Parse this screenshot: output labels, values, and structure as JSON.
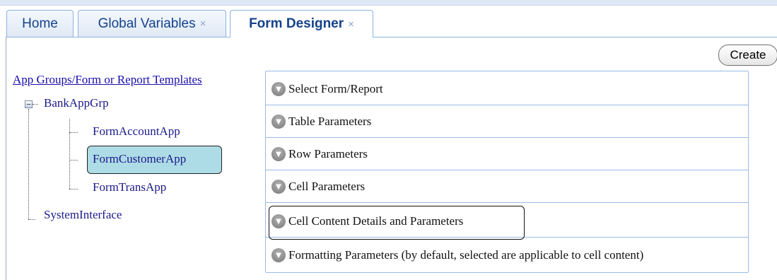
{
  "tabs": [
    {
      "label": "Home",
      "closable": false,
      "active": false
    },
    {
      "label": "Global Variables",
      "closable": true,
      "active": false
    },
    {
      "label": "Form Designer",
      "closable": true,
      "active": true
    }
  ],
  "close_glyph": "×",
  "toolbar": {
    "create_label": "Create"
  },
  "tree": {
    "root_link": "App Groups/Form or Report Templates",
    "expander_glyph": "−",
    "group": "BankAppGrp",
    "children": [
      "FormAccountApp",
      "FormCustomerApp",
      "FormTransApp"
    ],
    "selected_child": "FormCustomerApp",
    "sibling": "SystemInterface"
  },
  "accordion": {
    "sections": [
      "Select Form/Report",
      "Table Parameters",
      "Row Parameters",
      "Cell Parameters",
      "Cell Content Details and Parameters",
      "Formatting Parameters (by default, selected are applicable to cell content)"
    ],
    "highlighted": "Cell Content Details and Parameters"
  },
  "colors": {
    "selected_bg": "#aedce6",
    "tab_border": "#8db2e3",
    "link": "#1a0dab"
  }
}
